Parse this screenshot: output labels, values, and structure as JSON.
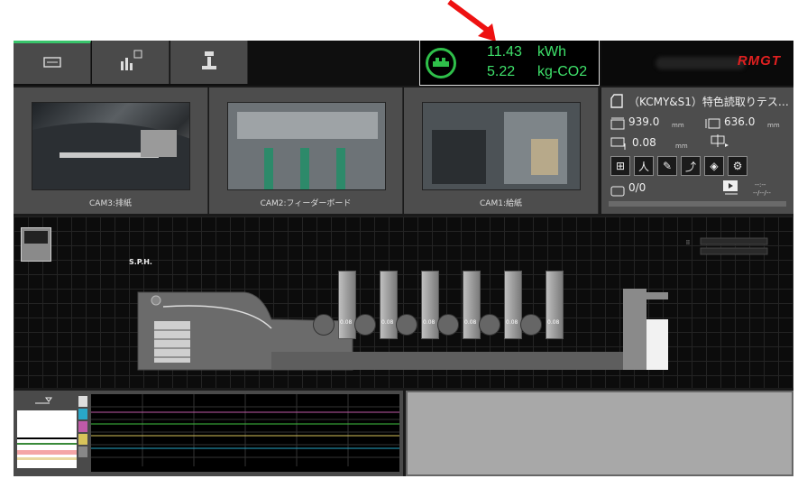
{
  "energy": {
    "kwh_value": "11.43",
    "kwh_unit": "kWh",
    "co2_value": "5.22",
    "co2_unit": "kg-CO2"
  },
  "brand": {
    "logo": "RMGT"
  },
  "cameras": [
    {
      "label": "CAM3:排紙"
    },
    {
      "label": "CAM2:フィーダーボード"
    },
    {
      "label": "CAM1:給紙"
    }
  ],
  "job": {
    "name": "（KCMY&S1）特色読取りテス…",
    "sheet_width": "939.0",
    "sheet_height": "636.0",
    "thickness": "0.08",
    "unit_mm": "mm",
    "count": "0/0",
    "time": "--:--",
    "date": "--/--/--"
  },
  "machine": {
    "sph_label": "S.P.H.",
    "unit_value": "0.08"
  },
  "colors": {
    "accent_green": "#3ee06a",
    "brand_red": "#e02020",
    "arrow_red": "#ee1111"
  }
}
